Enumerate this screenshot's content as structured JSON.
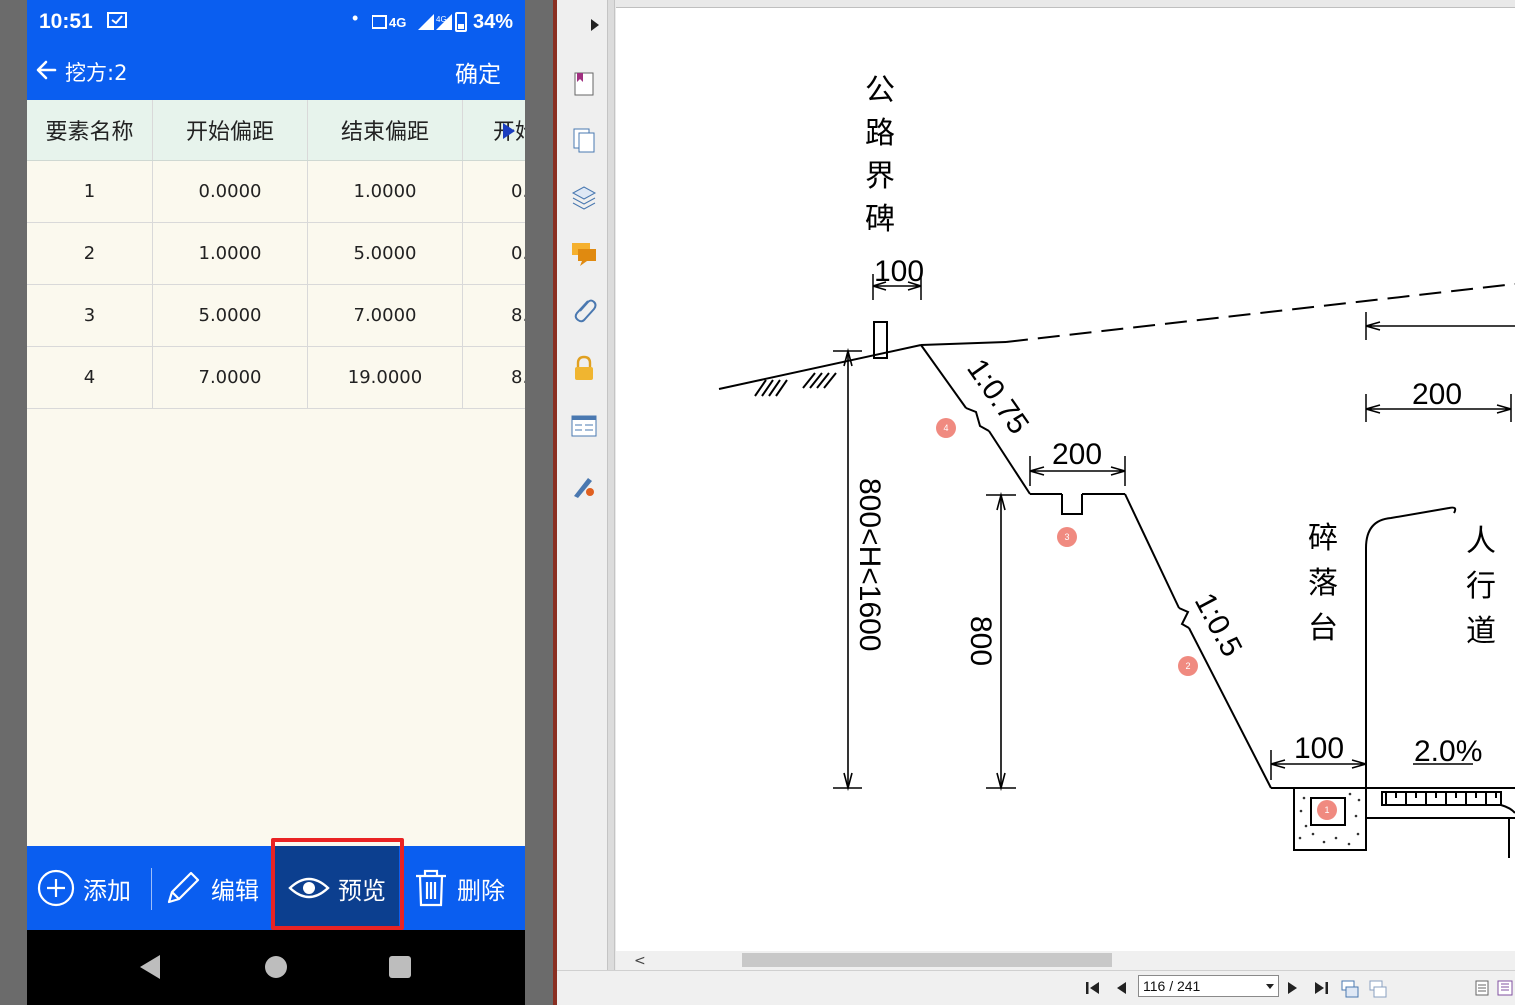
{
  "status_bar": {
    "time": "10:51",
    "signal_text": "4G",
    "battery": "34%"
  },
  "app_bar": {
    "title": "挖方:2",
    "confirm": "确定"
  },
  "table": {
    "columns": [
      "要素名称",
      "开始偏距",
      "结束偏距",
      "开始"
    ],
    "rows": [
      [
        "1",
        "0.0000",
        "1.0000",
        "0."
      ],
      [
        "2",
        "1.0000",
        "5.0000",
        "0."
      ],
      [
        "3",
        "5.0000",
        "7.0000",
        "8."
      ],
      [
        "4",
        "7.0000",
        "19.0000",
        "8."
      ]
    ]
  },
  "toolbar": {
    "add": "添加",
    "edit": "编辑",
    "preview": "预览",
    "delete": "删除"
  },
  "pdf_viewer": {
    "page_indicator": "116 / 241",
    "drawing": {
      "labels": {
        "boundary_marker": "公路界碑",
        "dim_marker_width": "100",
        "slope_upper": "1:0.75",
        "berm_width": "200",
        "height_range": "800<H<1600",
        "height_800": "800",
        "slope_lower": "1:0.5",
        "debris_platform": "碎落台",
        "sidewalk": "人行道",
        "ditch_width": "100",
        "cross_slope": "2.0%",
        "right_width": "200"
      },
      "markers": [
        "4",
        "3",
        "2",
        "1"
      ]
    }
  },
  "colors": {
    "app_blue": "#0a5ef0",
    "preview_selected": "#0c3f8f",
    "highlight_red": "#e92323",
    "marker_red": "#f08a80"
  }
}
